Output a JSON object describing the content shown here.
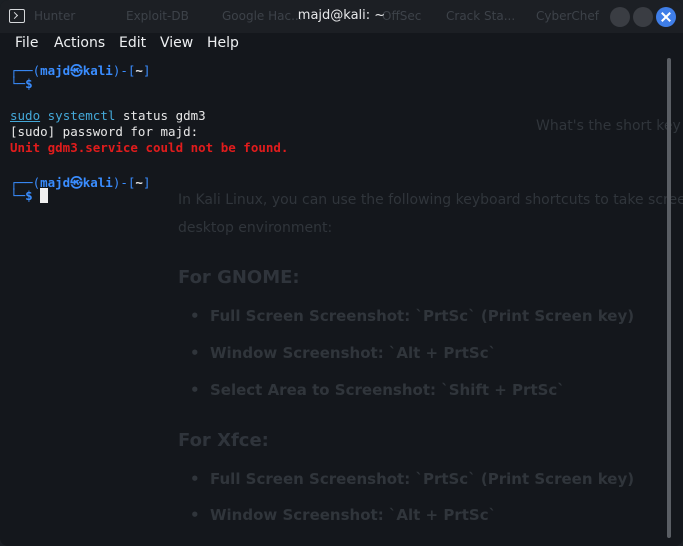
{
  "window": {
    "title": "majd@kali: ~",
    "background_tabs": [
      "Hunter",
      "Exploit-DB",
      "Google Hac...",
      "OffSec",
      "Crack Sta...",
      "CyberChef"
    ]
  },
  "menu": {
    "items": [
      "File",
      "Actions",
      "Edit",
      "View",
      "Help"
    ]
  },
  "terminal": {
    "prompt1": {
      "open": "┌──(",
      "user": "majd",
      "at": "㉿",
      "host": "kali",
      "mid": ")-[",
      "path": "~",
      "close": "]",
      "lead": "└─",
      "symbol": "$"
    },
    "cmd_sudo": "sudo",
    "cmd_systemctl": "systemctl",
    "cmd_args": " status gdm3",
    "line_password": "[sudo] password for majd:",
    "line_error": "Unit gdm3.service could not be found.",
    "prompt2": {
      "open": "┌──(",
      "user": "majd",
      "at": "㉿",
      "host": "kali",
      "mid": ")-[",
      "path": "~",
      "close": "]",
      "lead": "└─",
      "symbol": "$"
    }
  },
  "background_page": {
    "question": "What's the short key",
    "intro1": "In Kali Linux, you can use the following keyboard shortcuts to take scree",
    "intro2": "desktop environment:",
    "gnome_heading": "For GNOME:",
    "gnome_items": [
      "Full Screen Screenshot: `PrtSc` (Print Screen key)",
      "Window Screenshot: `Alt + PrtSc`",
      "Select Area to Screenshot: `Shift + PrtSc`"
    ],
    "xfce_heading": "For Xfce:",
    "xfce_items": [
      "Full Screen Screenshot: `PrtSc` (Print Screen key)",
      "Window Screenshot: `Alt + PrtSc`"
    ]
  },
  "colors": {
    "prompt_blue": "#3a8dff",
    "command_cyan": "#44a8d8",
    "error_red": "#e11c1c",
    "close_button": "#3f7ee8"
  }
}
